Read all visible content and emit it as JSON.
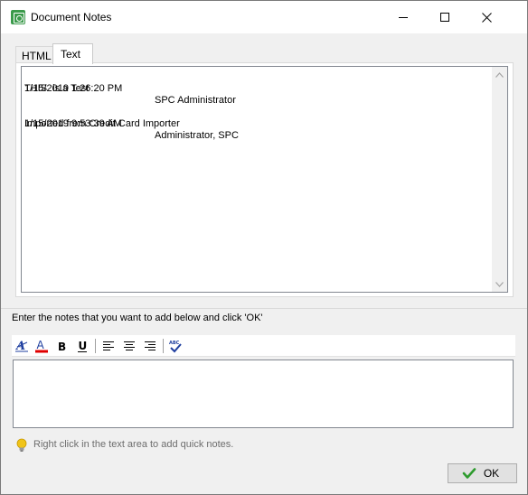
{
  "window": {
    "title": "Document Notes"
  },
  "tabs": [
    {
      "label": "HTML",
      "selected": false
    },
    {
      "label": "Text",
      "selected": true
    }
  ],
  "notes": [
    {
      "timestamp": "1/15/2019 1:26:20 PM",
      "user": "SPC Administrator",
      "text": "THIS  is a Test"
    },
    {
      "timestamp": "1/15/2019 9:53:39 AM",
      "user": "Administrator, SPC",
      "text": "Imported from Credit Card Importer"
    }
  ],
  "instruction": "Enter the notes that you want to add below and click 'OK'",
  "toolbar": {
    "items": [
      {
        "name": "font-style-icon"
      },
      {
        "name": "font-color-icon",
        "color": "#e00000"
      },
      {
        "name": "bold-icon",
        "glyph": "B"
      },
      {
        "name": "underline-icon",
        "glyph": "U"
      },
      {
        "name": "align-left-icon"
      },
      {
        "name": "align-center-icon"
      },
      {
        "name": "align-right-icon"
      },
      {
        "name": "spellcheck-icon"
      }
    ]
  },
  "new_note": {
    "value": ""
  },
  "hint": "Right click in the text area to add quick notes.",
  "buttons": {
    "ok_label": "OK"
  },
  "colors": {
    "app_icon": "#3b9a4b",
    "ok_check": "#2e9b2e",
    "hint_bulb": "#f0c419"
  }
}
